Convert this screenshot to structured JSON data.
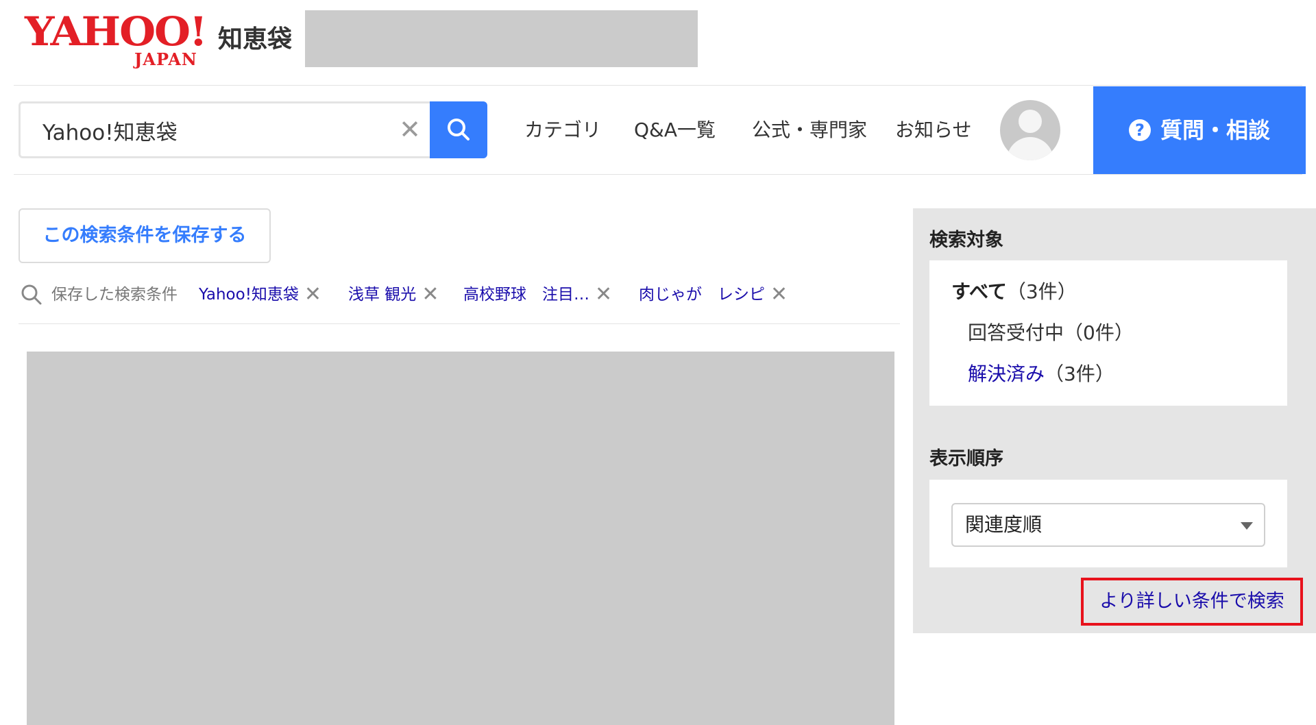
{
  "header": {
    "logo_brand": "YAHOO!",
    "logo_region": "JAPAN",
    "service_name": "知恵袋",
    "nav": [
      {
        "label": "カテゴリ"
      },
      {
        "label": "Q&A一覧"
      },
      {
        "label": "公式・専門家"
      },
      {
        "label": "お知らせ"
      }
    ],
    "ask_button": {
      "icon": "?",
      "label": "質問・相談"
    }
  },
  "search": {
    "value": "Yahoo!知恵袋",
    "clear_icon": "✕",
    "submit_icon": "search-icon"
  },
  "save_condition_button": "この検索条件を保存する",
  "saved_conditions": {
    "label": "保存した検索条件",
    "tags": [
      {
        "text": "Yahoo!知恵袋"
      },
      {
        "text": "浅草 観光"
      },
      {
        "text": "高校野球　注目…"
      },
      {
        "text": "肉じゃが　レシピ"
      }
    ],
    "remove_icon": "✕"
  },
  "sidebar": {
    "target_heading": "検索対象",
    "filters": [
      {
        "label": "すべて",
        "count": "（3件）",
        "state": "active"
      },
      {
        "label": "回答受付中",
        "count": "（0件）",
        "state": "plain"
      },
      {
        "label": "解決済み",
        "count": "（3件）",
        "state": "link"
      }
    ],
    "order_heading": "表示順序",
    "order_select": "関連度順",
    "advanced_search_link": "より詳しい条件で検索"
  },
  "colors": {
    "brand_red": "#e31f26",
    "accent_blue": "#357dfd",
    "link_blue": "#1a0dab",
    "highlight_red": "#e8121c"
  }
}
